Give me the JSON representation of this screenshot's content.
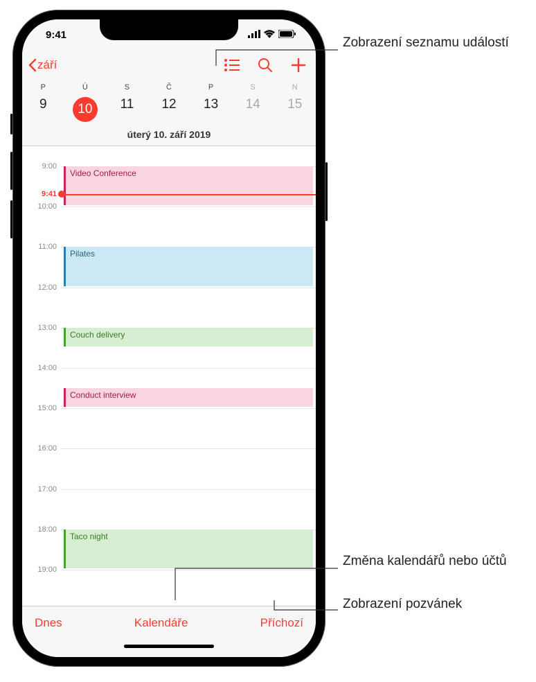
{
  "status": {
    "time": "9:41"
  },
  "nav": {
    "back_label": "září"
  },
  "week": {
    "dow": [
      "P",
      "Ú",
      "S",
      "Č",
      "P",
      "S",
      "N"
    ],
    "days": [
      {
        "n": "9",
        "weekend": false,
        "selected": false
      },
      {
        "n": "10",
        "weekend": false,
        "selected": true
      },
      {
        "n": "11",
        "weekend": false,
        "selected": false
      },
      {
        "n": "12",
        "weekend": false,
        "selected": false
      },
      {
        "n": "13",
        "weekend": false,
        "selected": false
      },
      {
        "n": "14",
        "weekend": true,
        "selected": false
      },
      {
        "n": "15",
        "weekend": true,
        "selected": false
      }
    ],
    "full_date": "úterý 10. září 2019"
  },
  "hours": [
    "9:00",
    "10:00",
    "11:00",
    "12:00",
    "13:00",
    "14:00",
    "15:00",
    "16:00",
    "17:00",
    "18:00",
    "19:00"
  ],
  "now": {
    "label": "9:41"
  },
  "events": [
    {
      "title": "Video Conference",
      "color": "pink",
      "start": 9.0,
      "end": 10.0
    },
    {
      "title": "Pilates",
      "color": "blue",
      "start": 11.0,
      "end": 12.0
    },
    {
      "title": "Couch delivery",
      "color": "green",
      "start": 13.0,
      "end": 13.5
    },
    {
      "title": "Conduct interview",
      "color": "pink",
      "start": 14.5,
      "end": 15.0
    },
    {
      "title": "Taco night",
      "color": "green",
      "start": 18.0,
      "end": 19.0
    }
  ],
  "toolbar": {
    "today": "Dnes",
    "calendars": "Kalendáře",
    "inbox": "Příchozí"
  },
  "callouts": {
    "list": "Zobrazení seznamu událostí",
    "calendars": "Změna kalendářů nebo účtů",
    "inbox": "Zobrazení pozvánek"
  },
  "colors": {
    "accent": "#ff3b30"
  }
}
